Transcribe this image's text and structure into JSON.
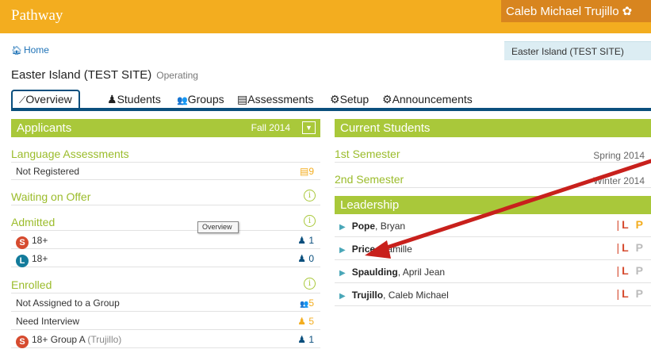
{
  "header": {
    "brand": "Pathway",
    "user": "Caleb Michael Trujillo"
  },
  "breadcrumb": {
    "home": "Home"
  },
  "site_select": {
    "value": "Easter Island (TEST SITE)"
  },
  "site": {
    "name": "Easter Island (TEST SITE)",
    "status": "Operating"
  },
  "tabs": [
    {
      "icon": "📈",
      "label": "Overview"
    },
    {
      "icon": "♟",
      "label": "Students"
    },
    {
      "icon": "👥",
      "label": "Groups"
    },
    {
      "icon": "▤",
      "label": "Assessments"
    },
    {
      "icon": "⚙",
      "label": "Setup"
    },
    {
      "icon": "⚙",
      "label": "Announcements"
    }
  ],
  "applicants": {
    "title": "Applicants",
    "term": "Fall 2014",
    "language": {
      "title": "Language Assessments",
      "rows": [
        {
          "label": "Not Registered",
          "count": "9"
        }
      ]
    },
    "waiting": {
      "title": "Waiting on Offer"
    },
    "admitted": {
      "title": "Admitted",
      "rows": [
        {
          "badge": "S",
          "label": "18+",
          "count": "1"
        },
        {
          "badge": "L",
          "label": "18+",
          "count": "0"
        }
      ]
    },
    "enrolled": {
      "title": "Enrolled",
      "rows": [
        {
          "label": "Not Assigned to a Group",
          "count": "5"
        },
        {
          "label": "Need Interview",
          "count": "5"
        },
        {
          "badge": "S",
          "label": "18+ Group A",
          "note": "(Trujillo)",
          "count": "1"
        }
      ]
    }
  },
  "current": {
    "title": "Current Students",
    "semesters": [
      {
        "label": "1st Semester",
        "term": "Spring 2014"
      },
      {
        "label": "2nd Semester",
        "term": "Winter 2014"
      }
    ]
  },
  "leadership": {
    "title": "Leadership",
    "rows": [
      {
        "last": "Pope",
        "first": "Bryan",
        "l": "L",
        "p": "P"
      },
      {
        "last": "Price",
        "first": "Camille",
        "l": "L",
        "p": "P"
      },
      {
        "last": "Spaulding",
        "first": "April Jean",
        "l": "L",
        "p": "P"
      },
      {
        "last": "Trujillo",
        "first": "Caleb Michael",
        "l": "L",
        "p": "P"
      }
    ]
  },
  "tooltip": "Overview",
  "colors": {
    "topbar": "#f3ad1f",
    "user_bg": "#d8851f",
    "green": "#a9c83a",
    "navy": "#0a4f7d",
    "annotation_arrow": "#c8201c"
  }
}
